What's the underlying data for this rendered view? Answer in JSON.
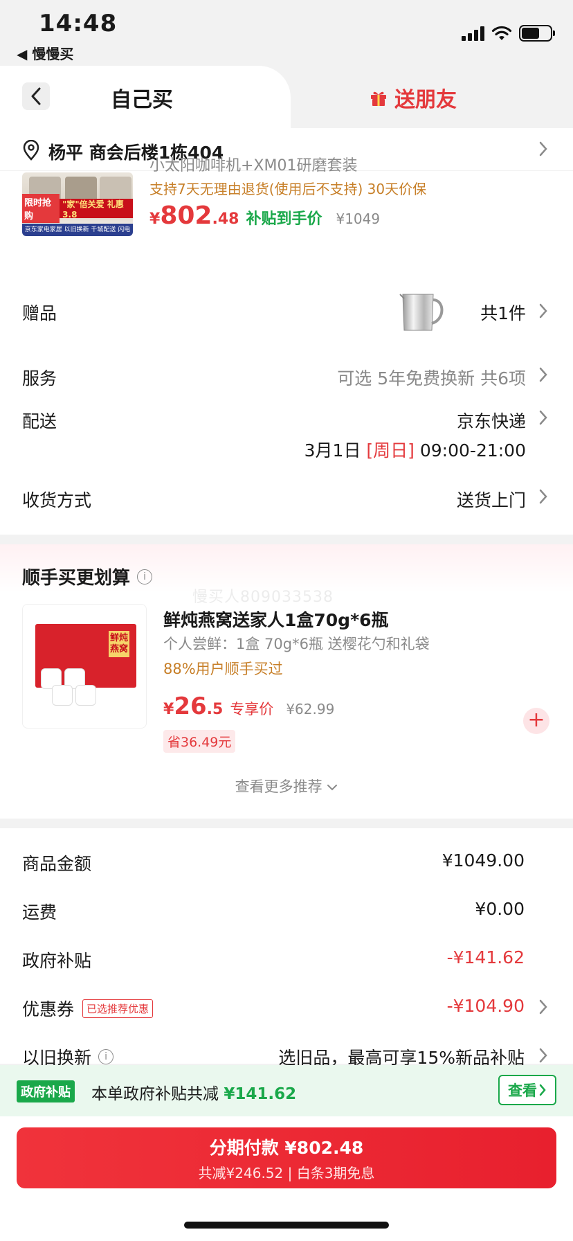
{
  "status_bar": {
    "time": "14:48",
    "back_app": "◀ 慢慢买"
  },
  "tabs": {
    "self": "自己买",
    "friend": "送朋友"
  },
  "address": {
    "text": "杨平  商会后楼1栋404"
  },
  "product": {
    "name": "小太阳咖啡机+XM01研磨套装",
    "policy": "支持7天无理由退货(使用后不支持)  30天价保",
    "price_symbol": "¥",
    "price_int": "802",
    "price_dec": ".48",
    "price_label": "补贴到手价",
    "orig_price": "¥1049",
    "thumb_promo_a": "限时抢购",
    "thumb_promo_b": "\"家\"倍关爱 礼惠3.8",
    "thumb_strip": "京东家电家居  以旧换新  千城配送  闪电发货"
  },
  "gift": {
    "label": "赠品",
    "count": "共1件"
  },
  "service": {
    "label": "服务",
    "value": "可选 5年免费换新 共6项"
  },
  "delivery": {
    "label": "配送",
    "carrier": "京东快递",
    "date": "3月1日",
    "weekday": "[周日]",
    "window": "09:00-21:00"
  },
  "receive": {
    "label": "收货方式",
    "value": "送货上门"
  },
  "recommend": {
    "title": "顺手买更划算",
    "watermark": "慢买人809033538",
    "name": "鲜炖燕窝送家人1盒70g*6瓶",
    "desc": "个人尝鲜：1盒 70g*6瓶 送樱花勺和礼袋",
    "users": "88%用户顺手买过",
    "price_symbol": "¥",
    "price_int": "26",
    "price_dec": ".5",
    "price_label": "专享价",
    "orig_price": "¥62.99",
    "save": "省36.49元",
    "box_label": "鲜炖燕窝",
    "more": "查看更多推荐"
  },
  "summary": {
    "goods_label": "商品金额",
    "goods_value": "¥1049.00",
    "shipping_label": "运费",
    "shipping_value": "¥0.00",
    "gov_label": "政府补贴",
    "gov_value": "-¥141.62",
    "coupon_label": "优惠券",
    "coupon_tag": "已选推荐优惠",
    "coupon_value": "-¥104.90",
    "tradein_label": "以旧换新",
    "tradein_value": "选旧品，最高可享15%新品补贴"
  },
  "subsidy": {
    "tag": "政府补贴",
    "text": "本单政府补贴共减",
    "amount": "¥141.62",
    "button": "查看"
  },
  "pay": {
    "main": "分期付款 ¥802.48",
    "sub": "共减¥246.52 | 白条3期免息"
  },
  "colors": {
    "accent_red": "#e4393c",
    "green": "#1aa84a",
    "orange": "#c77f28",
    "grey": "#8a8a8a"
  }
}
